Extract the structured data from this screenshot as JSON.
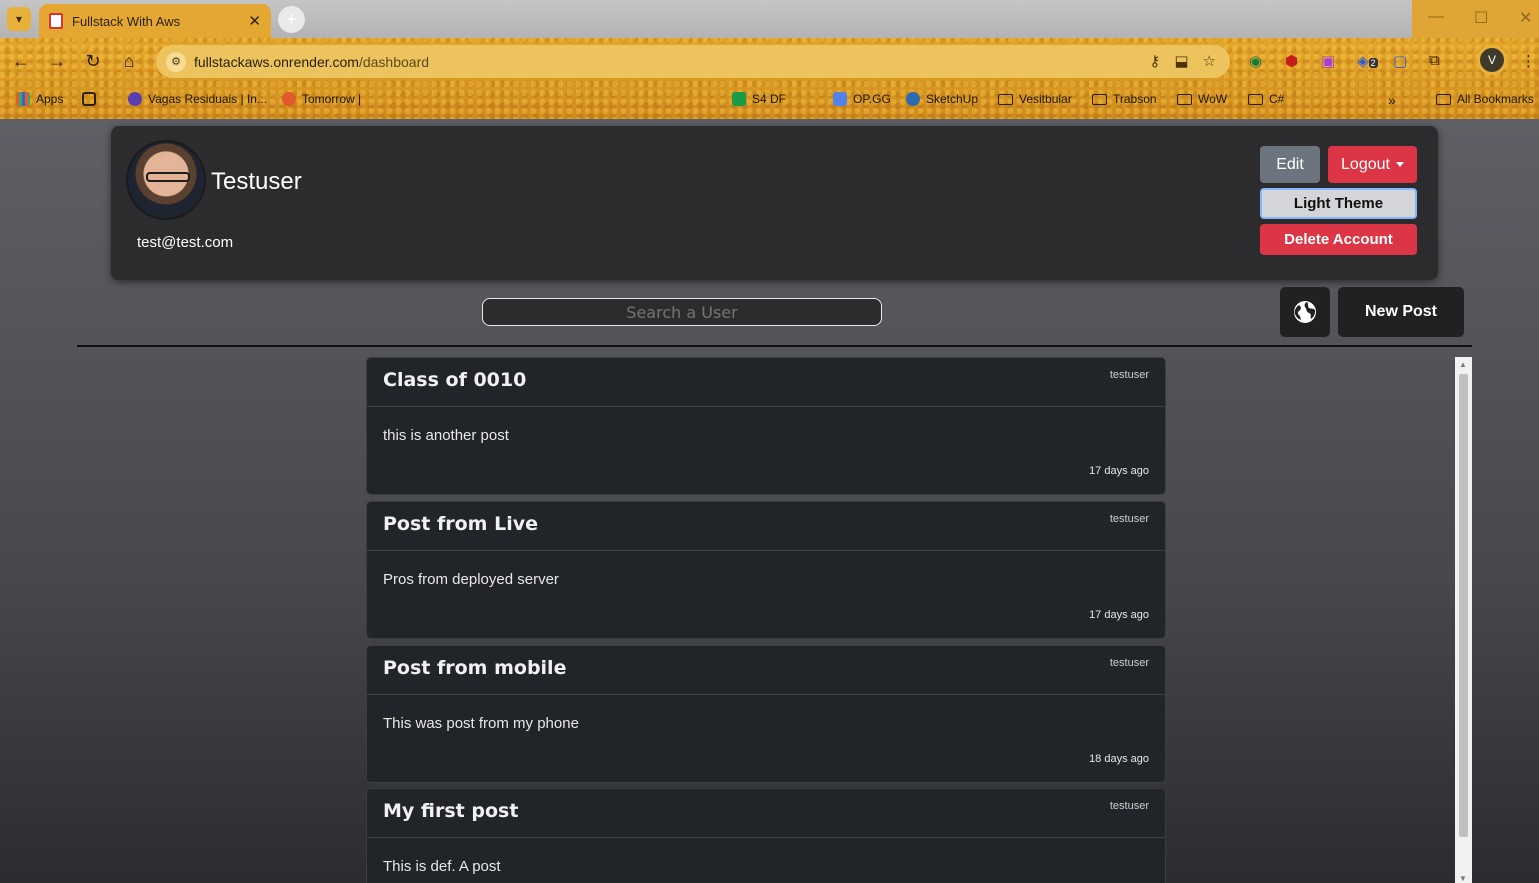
{
  "browser": {
    "tab_title": "Fullstack With Aws",
    "url_host": "fullstackaws.onrender.com",
    "url_path": "/dashboard",
    "extension_badge": "2",
    "profile_initial": "V",
    "bookmarks": [
      {
        "label": "Apps",
        "type": "apps"
      },
      {
        "label": "Vagas Residuais | In...",
        "type": "site"
      },
      {
        "label": "Tomorrow |",
        "type": "site"
      },
      {
        "label": "S4 DF",
        "type": "site"
      },
      {
        "label": "OP.GG",
        "type": "site"
      },
      {
        "label": "SketchUp",
        "type": "site"
      },
      {
        "label": "Vesitbular",
        "type": "folder"
      },
      {
        "label": "Trabson",
        "type": "folder"
      },
      {
        "label": "WoW",
        "type": "folder"
      },
      {
        "label": "C#",
        "type": "folder"
      },
      {
        "label": "All Bookmarks",
        "type": "folder"
      }
    ]
  },
  "profile": {
    "name": "Testuser",
    "email": "test@test.com"
  },
  "actions": {
    "edit": "Edit",
    "logout": "Logout",
    "theme": "Light Theme",
    "delete": "Delete Account"
  },
  "search": {
    "placeholder": "Search a User"
  },
  "new_post": "New Post",
  "posts": [
    {
      "title": "Class of 0010",
      "author": "testuser",
      "body": "this is another post",
      "time": "17 days ago"
    },
    {
      "title": "Post from Live",
      "author": "testuser",
      "body": "Pros from deployed server",
      "time": "17 days ago"
    },
    {
      "title": "Post from mobile",
      "author": "testuser",
      "body": "This was post from my phone",
      "time": "18 days ago"
    },
    {
      "title": "My first post",
      "author": "testuser",
      "body": "This is def. A post",
      "time": ""
    }
  ],
  "colors": {
    "danger": "#dc3545",
    "secondary": "#6c757d",
    "card": "#212529"
  }
}
